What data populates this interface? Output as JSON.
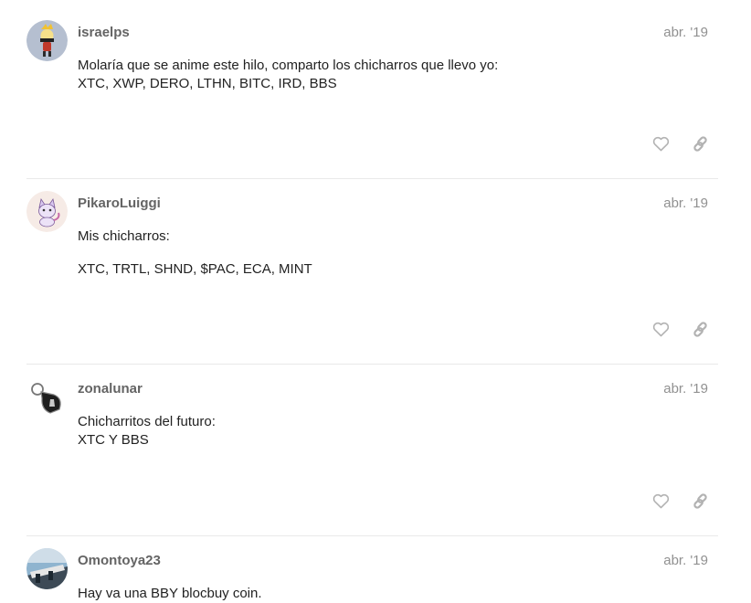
{
  "posts": [
    {
      "username": "israelps",
      "date": "abr. '19",
      "paragraphs": [
        [
          "Molaría que se anime este hilo, comparto los chicharros que llevo yo:",
          "XTC, XWP, DERO, LTHN, BITC, IRD, BBS"
        ]
      ],
      "avatar_icon": "cartoon-character-avatar"
    },
    {
      "username": "PikaroLuiggi",
      "date": "abr. '19",
      "paragraphs": [
        [
          "Mis chicharros:"
        ],
        [
          "XTC, TRTL, SHND, $PAC, ECA, MINT"
        ]
      ],
      "avatar_icon": "cat-avatar"
    },
    {
      "username": "zonalunar",
      "date": "abr. '19",
      "paragraphs": [
        [
          "Chicharritos del futuro:",
          "XTC Y BBS"
        ]
      ],
      "avatar_icon": "keychain-avatar"
    },
    {
      "username": "Omontoya23",
      "date": "abr. '19",
      "paragraphs": [
        [
          "Hay va una BBY blocbuy coin."
        ]
      ],
      "avatar_icon": "photo-avatar"
    }
  ],
  "colors": {
    "username": "#646464",
    "date": "#919191",
    "text": "#222222",
    "icon": "#b2b2b2",
    "divider": "#e9e9e9"
  }
}
